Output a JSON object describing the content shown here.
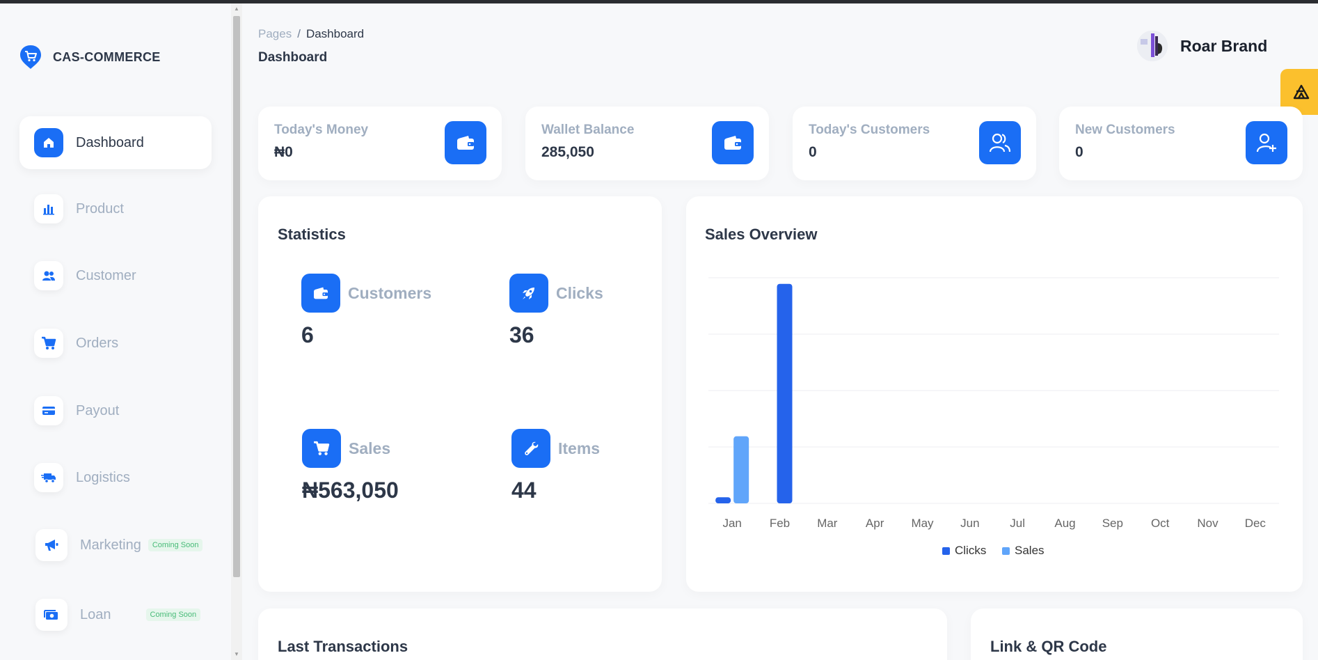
{
  "app": {
    "brand": "CAS-COMMERCE"
  },
  "sidebar": {
    "items": [
      {
        "label": "Dashboard",
        "icon": "home-icon"
      },
      {
        "label": "Product",
        "icon": "bar-chart-icon"
      },
      {
        "label": "Customer",
        "icon": "users-icon"
      },
      {
        "label": "Orders",
        "icon": "cart-icon"
      },
      {
        "label": "Payout",
        "icon": "card-icon"
      },
      {
        "label": "Logistics",
        "icon": "truck-icon"
      },
      {
        "label": "Marketing",
        "icon": "megaphone-icon",
        "badge": "Coming Soon"
      },
      {
        "label": "Loan",
        "icon": "money-icon",
        "badge": "Coming Soon"
      }
    ]
  },
  "header": {
    "breadcrumb_root": "Pages",
    "breadcrumb_sep": "/",
    "breadcrumb_current": "Dashboard",
    "title": "Dashboard",
    "user_name": "Roar Brand"
  },
  "stats": [
    {
      "label": "Today's Money",
      "value": "₦0",
      "icon": "wallet-icon"
    },
    {
      "label": "Wallet Balance",
      "value": "285,050",
      "icon": "wallet-icon"
    },
    {
      "label": "Today's Customers",
      "value": "0",
      "icon": "users-icon"
    },
    {
      "label": "New Customers",
      "value": "0",
      "icon": "user-plus-icon"
    }
  ],
  "statistics": {
    "title": "Statistics",
    "metrics": [
      {
        "label": "Customers",
        "value": "6",
        "icon": "wallet-icon"
      },
      {
        "label": "Clicks",
        "value": "36",
        "icon": "rocket-icon"
      },
      {
        "label": "Sales",
        "value": "₦563,050",
        "icon": "cart-icon"
      },
      {
        "label": "Items",
        "value": "44",
        "icon": "wrench-icon"
      }
    ]
  },
  "sales_overview": {
    "title": "Sales Overview"
  },
  "chart_data": {
    "type": "bar",
    "categories": [
      "Jan",
      "Feb",
      "Mar",
      "Apr",
      "May",
      "Jun",
      "Jul",
      "Aug",
      "Sep",
      "Oct",
      "Nov",
      "Dec"
    ],
    "series": [
      {
        "name": "Clicks",
        "color": "#2563eb",
        "values": [
          1,
          36,
          0,
          0,
          0,
          0,
          0,
          0,
          0,
          0,
          0,
          0
        ]
      },
      {
        "name": "Sales",
        "color": "#60a5fa",
        "values": [
          11,
          0,
          0,
          0,
          0,
          0,
          0,
          0,
          0,
          0,
          0,
          0
        ]
      }
    ],
    "ylim": [
      0,
      37
    ],
    "grid": true,
    "legend": "bottom"
  },
  "sections": {
    "last_transactions": "Last Transactions",
    "link_qr": "Link & QR Code"
  },
  "colors": {
    "accent": "#1a6ef5",
    "coming_soon": "#48bb78",
    "floating_button": "#fbc02d"
  }
}
